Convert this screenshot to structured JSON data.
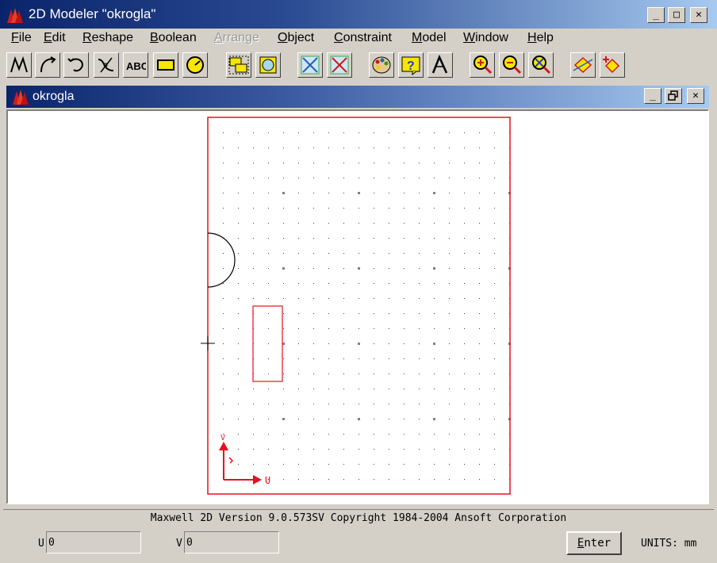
{
  "window": {
    "title": "2D Modeler \"okrogla\""
  },
  "window_controls": {
    "minimize": "_",
    "maximize": "□",
    "close": "✕"
  },
  "menu": [
    {
      "label": "File",
      "mnemonic": "F",
      "rest": "ile",
      "disabled": false
    },
    {
      "label": "Edit",
      "mnemonic": "E",
      "rest": "dit",
      "disabled": false
    },
    {
      "label": "Reshape",
      "mnemonic": "R",
      "rest": "eshape",
      "disabled": false
    },
    {
      "label": "Boolean",
      "mnemonic": "B",
      "rest": "oolean",
      "disabled": false
    },
    {
      "label": "Arrange",
      "mnemonic": "A",
      "rest": "rrange",
      "disabled": true
    },
    {
      "label": "Object",
      "mnemonic": "O",
      "rest": "bject",
      "disabled": false
    },
    {
      "label": "Constraint",
      "mnemonic": "C",
      "rest": "onstraint",
      "disabled": false
    },
    {
      "label": "Model",
      "mnemonic": "M",
      "rest": "odel",
      "disabled": false
    },
    {
      "label": "Window",
      "mnemonic": "W",
      "rest": "indow",
      "disabled": false
    },
    {
      "label": "Help",
      "mnemonic": "H",
      "rest": "elp",
      "disabled": false
    }
  ],
  "toolbar": {
    "buttons": [
      {
        "icon": "polyline-icon"
      },
      {
        "icon": "arc-icon"
      },
      {
        "icon": "rotate-arc-icon"
      },
      {
        "icon": "spline-icon"
      },
      {
        "icon": "text-icon",
        "text": "ABC"
      },
      {
        "icon": "rectangle-icon"
      },
      {
        "icon": "circle-icon"
      },
      {
        "icon": "group-icon"
      },
      {
        "icon": "ungroup-icon"
      },
      {
        "icon": "intersect-icon"
      },
      {
        "icon": "subtract-icon"
      },
      {
        "icon": "palette-icon"
      },
      {
        "icon": "help-icon"
      },
      {
        "icon": "pointer-icon"
      },
      {
        "icon": "zoom-in-icon"
      },
      {
        "icon": "zoom-out-icon"
      },
      {
        "icon": "zoom-fit-icon"
      },
      {
        "icon": "fit-all-icon"
      },
      {
        "icon": "measure-icon"
      }
    ]
  },
  "child_window": {
    "title": "okrogla"
  },
  "canvas": {
    "axis_label_u": "U",
    "axis_label_v": "V",
    "colors": {
      "boundary": "#e8101a",
      "grid": "#404040",
      "arc": "#000000"
    }
  },
  "status": {
    "text": "Maxwell 2D   Version 9.0.573SV   Copyright 1984-2004 Ansoft Corporation"
  },
  "coords": {
    "u_label": "U",
    "u_value": "0",
    "v_label": "V",
    "v_value": "0"
  },
  "enter_button": {
    "label": "Enter",
    "mnemonic": "E",
    "rest": "nter"
  },
  "units": "UNITS: mm"
}
